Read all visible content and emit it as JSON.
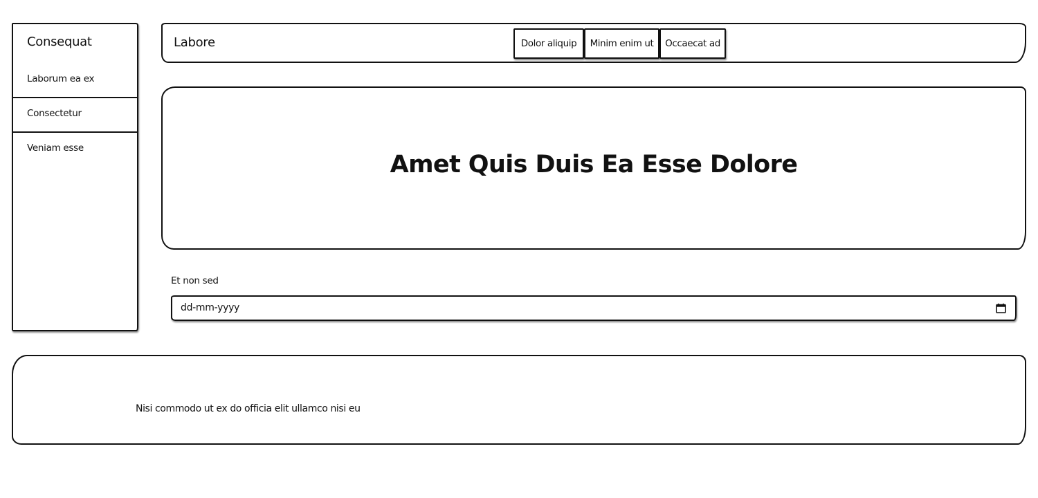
{
  "sidebar": {
    "title": "Consequat",
    "items": [
      {
        "label": "Laborum ea ex"
      },
      {
        "label": "Consectetur"
      },
      {
        "label": "Veniam esse"
      }
    ]
  },
  "header": {
    "title": "Labore",
    "nav": [
      {
        "label": "Dolor aliquip"
      },
      {
        "label": "Minim enim ut"
      },
      {
        "label": "Occaecat ad"
      }
    ]
  },
  "hero": {
    "title": "Amet Quis Duis Ea Esse Dolore"
  },
  "form": {
    "date_label": "Et non sed",
    "date_placeholder": "dd-mm-yyyy",
    "date_icon": "calendar-icon"
  },
  "footer": {
    "text": "Nisi commodo ut ex do officia elit ullamco nisi eu"
  }
}
